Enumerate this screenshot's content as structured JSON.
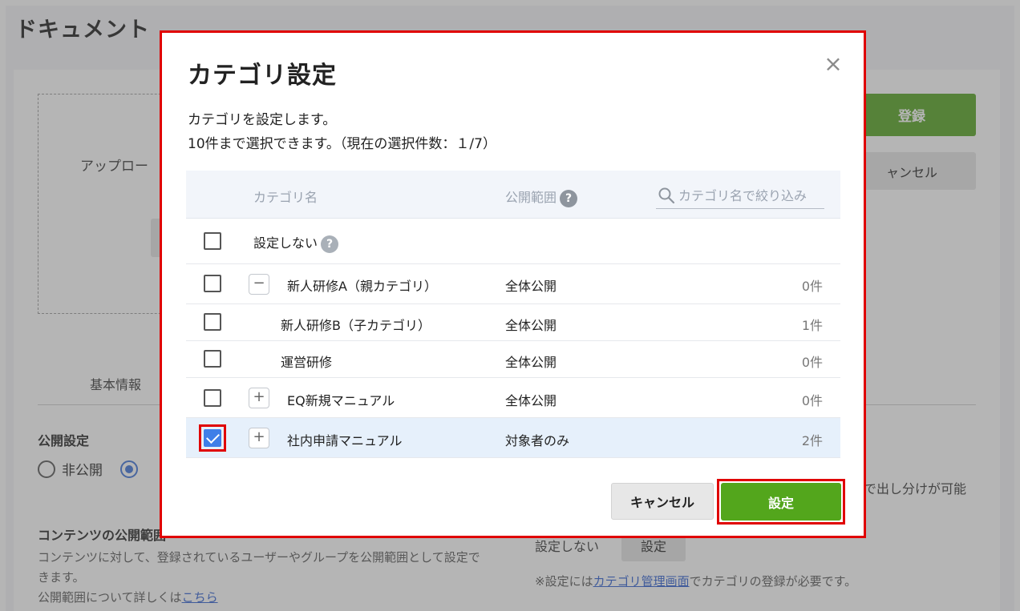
{
  "background": {
    "page_title": "ドキュメント",
    "upload_text": "アップロー",
    "register_button": "登録",
    "cancel_button": "ャンセル",
    "tab_basic": "基本情報",
    "publish_setting_title": "公開設定",
    "radio_private": "非公開",
    "right_note": "で出し分けが可能",
    "content_scope_title": "コンテンツの公開範囲",
    "content_scope_desc": "コンテンツに対して、登録されているユーザーやグループを公開範囲として設定できます。",
    "scope_detail_prefix": "公開範囲について詳しくは",
    "scope_detail_link": "こちら",
    "category_none": "設定しない",
    "category_set_button": "設定",
    "category_note_prefix": "※設定には",
    "category_note_link": "カテゴリ管理画面",
    "category_note_suffix": "でカテゴリの登録が必要です。"
  },
  "modal": {
    "title": "カテゴリ設定",
    "close_symbol": "×",
    "description_line1": "カテゴリを設定します。",
    "description_line2": "10件まで選択できます。（現在の選択件数：１/7）",
    "table": {
      "header_name": "カテゴリ名",
      "header_scope": "公開範囲",
      "help_symbol": "?",
      "search_placeholder": "カテゴリ名で絞り込み",
      "search_value": "",
      "rows": [
        {
          "name": "設定しない",
          "scope": "",
          "count": "",
          "checked": false,
          "toggle": "",
          "has_help": true
        },
        {
          "name": "新人研修A（親カテゴリ）",
          "scope": "全体公開",
          "count": "0件",
          "checked": false,
          "toggle": "−"
        },
        {
          "name": "新人研修B（子カテゴリ）",
          "scope": "全体公開",
          "count": "1件",
          "checked": false,
          "toggle": ""
        },
        {
          "name": "運営研修",
          "scope": "全体公開",
          "count": "0件",
          "checked": false,
          "toggle": ""
        },
        {
          "name": "EQ新規マニュアル",
          "scope": "全体公開",
          "count": "0件",
          "checked": false,
          "toggle": "+"
        },
        {
          "name": "社内申請マニュアル",
          "scope": "対象者のみ",
          "count": "2件",
          "checked": true,
          "toggle": "+"
        }
      ]
    },
    "cancel_button": "キャンセル",
    "set_button": "設定"
  },
  "colors": {
    "primary_green": "#53a61c",
    "highlight_red": "#e00000",
    "checkbox_blue": "#3f7fe8",
    "selected_row_bg": "#e6f0fb"
  }
}
